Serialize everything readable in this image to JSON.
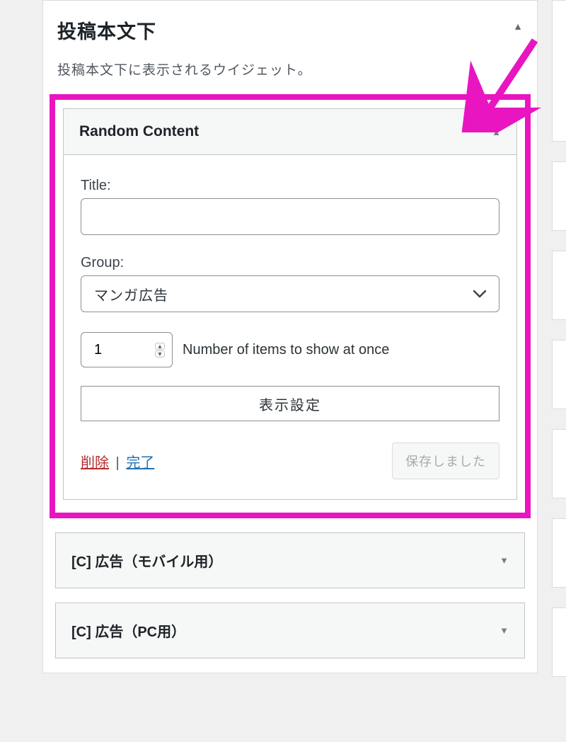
{
  "area": {
    "title": "投稿本文下",
    "description": "投稿本文下に表示されるウイジェット。"
  },
  "widget": {
    "title": "Random Content",
    "title_label": "Title:",
    "title_value": "",
    "group_label": "Group:",
    "group_value": "マンガ広告",
    "count_value": "1",
    "count_label": "Number of items to show at once",
    "display_settings_label": "表示設定",
    "delete_label": "削除",
    "done_label": "完了",
    "separator": " | ",
    "save_label": "保存しました"
  },
  "collapsed_widgets": [
    {
      "title": "[C] 広告（モバイル用）"
    },
    {
      "title": "[C] 広告（PC用）"
    }
  ]
}
